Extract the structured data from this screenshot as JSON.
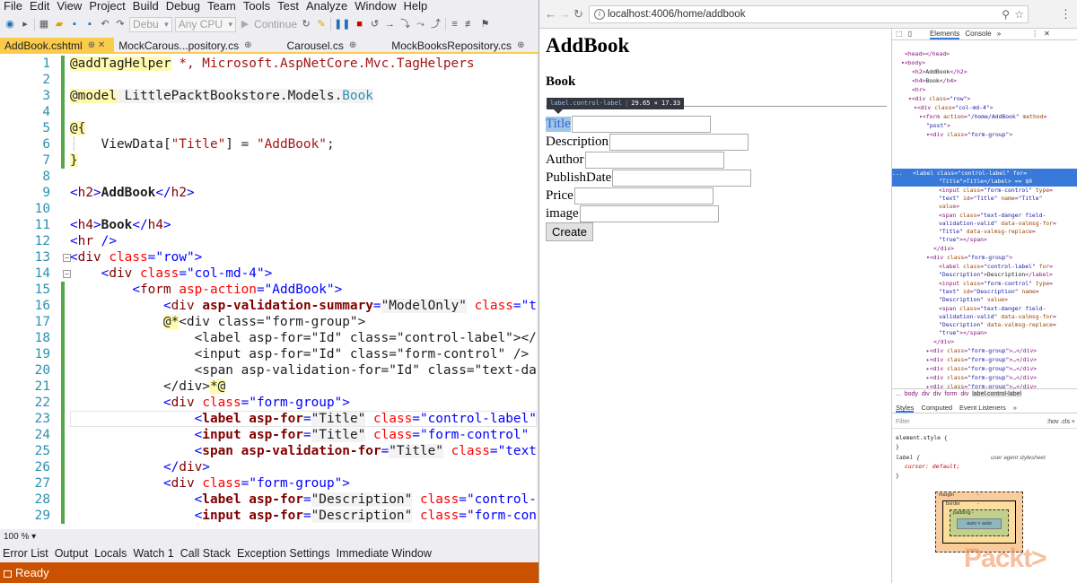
{
  "vs": {
    "menu": [
      "File",
      "Edit",
      "View",
      "Project",
      "Build",
      "Debug",
      "Team",
      "Tools",
      "Test",
      "Analyze",
      "Window",
      "Help"
    ],
    "toolbar": {
      "debug_combo": "Debu",
      "cpu_combo": "Any CPU",
      "continue": "Continue",
      "sep1": "|"
    },
    "tabs": [
      {
        "label": "AddBook.cshtml",
        "pin": "⊕ ✕",
        "active": true
      },
      {
        "label": "MockCarous...pository.cs",
        "pin": "⊕"
      },
      {
        "label": "Carousel.cs",
        "pin": "⊕"
      },
      {
        "label": "MockBooksRepository.cs",
        "pin": "⊕"
      }
    ],
    "zoom": "100 %",
    "bottom_tabs": [
      "Error List",
      "Output",
      "Locals",
      "Watch 1",
      "Call Stack",
      "Exception Settings",
      "Immediate Window"
    ],
    "status": "Ready"
  },
  "editor": {
    "line_numbers": [
      "1",
      "2",
      "3",
      "4",
      "5",
      "6",
      "7",
      "8",
      "9",
      "10",
      "11",
      "12",
      "13",
      "14",
      "15",
      "16",
      "17",
      "18",
      "19",
      "20",
      "21",
      "22",
      "23",
      "24",
      "25",
      "26",
      "27",
      "28",
      "29"
    ]
  },
  "browser": {
    "url": "localhost:4006/home/addbook",
    "page": {
      "title": "AddBook",
      "subtitle": "Book",
      "tooltip_tag": "label.control-label",
      "tooltip_size": "29.65 × 17.33",
      "fields": [
        "Title",
        "Description",
        "Author",
        "PublishDate",
        "Price",
        "image"
      ],
      "button": "Create"
    }
  },
  "devtools": {
    "tabs": [
      "Elements",
      "Console",
      "»"
    ],
    "breadcrumbs": [
      "...",
      "body",
      "div",
      "div",
      "form",
      "div",
      "label.control-label"
    ],
    "subtabs": [
      "Styles",
      "Computed",
      "Event Listeners",
      "»"
    ],
    "filter": "Filter",
    "filter_opts": ":hov .cls +",
    "styles": {
      "element_style": "element.style {",
      "close1": "}",
      "label_rule": "label {",
      "ua": "user agent stylesheet",
      "cursor": "cursor: default;",
      "close2": "}"
    },
    "boxmodel": {
      "margin": "margin",
      "border": "border",
      "padding": "padding -",
      "content": "auto × auto",
      "dash": "-"
    }
  },
  "watermark": "Packt>"
}
